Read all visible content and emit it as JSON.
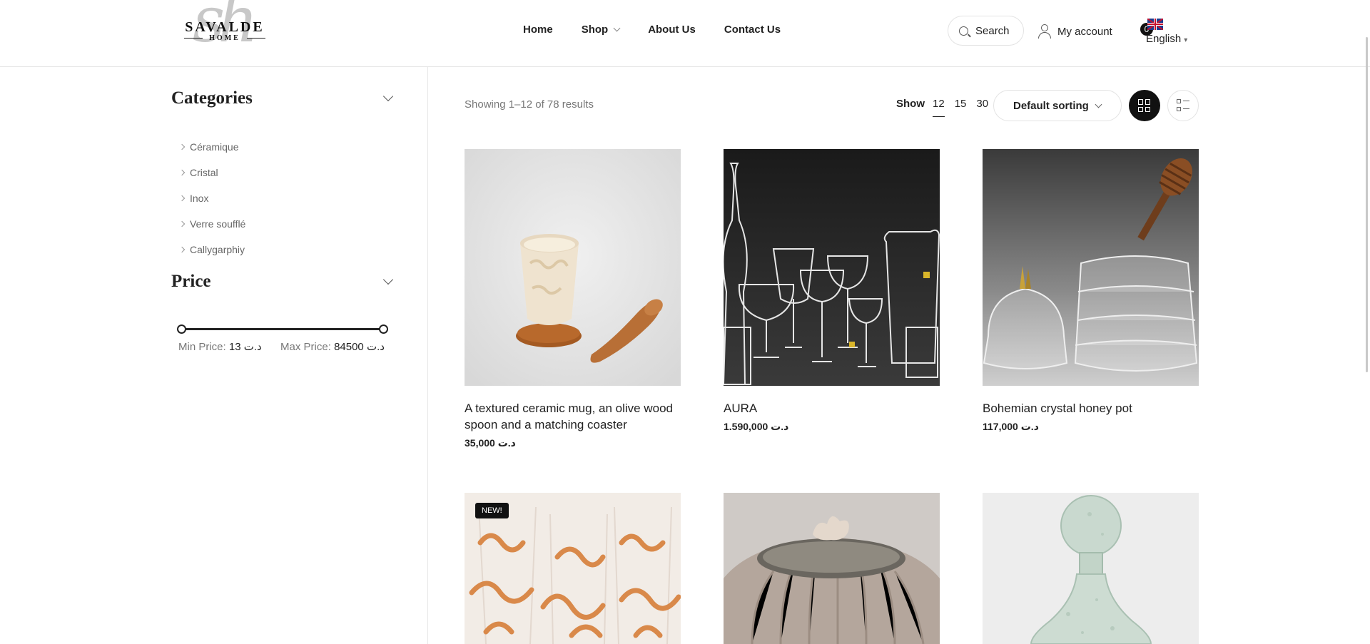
{
  "header": {
    "logo": {
      "monogram": "sh",
      "brand": "SAVALDE",
      "sub": "HOME"
    },
    "nav": [
      {
        "label": "Home"
      },
      {
        "label": "Shop",
        "has_dropdown": true
      },
      {
        "label": "About Us"
      },
      {
        "label": "Contact Us"
      }
    ],
    "search_label": "Search",
    "account_label": "My account",
    "language": {
      "badge": "0",
      "label": "English",
      "caret": "▾"
    }
  },
  "sidebar": {
    "categories": {
      "title": "Categories",
      "items": [
        {
          "label": "Céramique"
        },
        {
          "label": "Cristal"
        },
        {
          "label": "Inox"
        },
        {
          "label": "Verre soufflé"
        },
        {
          "label": "Callygarphiy"
        }
      ]
    },
    "price": {
      "title": "Price",
      "min_label": "Min Price:",
      "min_value": "13 د.ت",
      "max_label": "Max Price:",
      "max_value": "84500 د.ت",
      "range": [
        13,
        84500
      ]
    }
  },
  "toolbar": {
    "result_count": "Showing 1–12 of 78 results",
    "show_label": "Show",
    "show_options": [
      "12",
      "15",
      "30"
    ],
    "show_active": "12",
    "sorting_label": "Default sorting",
    "view_mode": "grid"
  },
  "products": [
    {
      "name": "A textured ceramic mug, an olive wood spoon and a matching coaster",
      "price": "35,000 د.ت"
    },
    {
      "name": "AURA",
      "price": "1.590,000 د.ت"
    },
    {
      "name": "Bohemian crystal honey pot",
      "price": "117,000 د.ت"
    },
    {
      "badge": "NEW!"
    },
    {},
    {}
  ],
  "colors": {
    "accent": "#111111",
    "border": "#e6e6e6",
    "muted_text": "#777777"
  }
}
